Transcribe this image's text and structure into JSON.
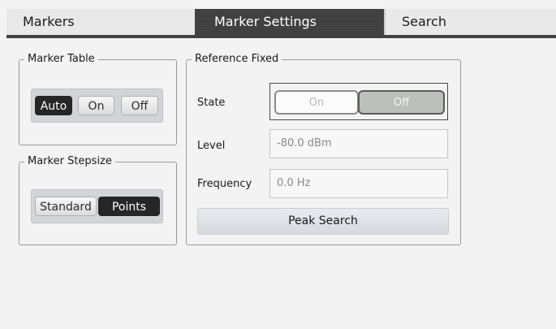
{
  "tabs": {
    "markers": "Markers",
    "marker_settings": "Marker Settings",
    "search": "Search",
    "active": "marker_settings"
  },
  "marker_table": {
    "title": "Marker Table",
    "options": [
      "Auto",
      "On",
      "Off"
    ],
    "selected": "Auto"
  },
  "marker_stepsize": {
    "title": "Marker Stepsize",
    "options": [
      "Standard",
      "Points"
    ],
    "selected": "Points"
  },
  "reference_fixed": {
    "title": "Reference Fixed",
    "state_label": "State",
    "state_on": "On",
    "state_off": "Off",
    "state_selected": "Off",
    "level_label": "Level",
    "level_value": "-80.0 dBm",
    "frequency_label": "Frequency",
    "frequency_value": "0.0 Hz",
    "peak_search_label": "Peak Search"
  },
  "colors": {
    "active_tab": "#3d3d3d",
    "active_button": "#262626",
    "background": "#f3f3f3"
  }
}
